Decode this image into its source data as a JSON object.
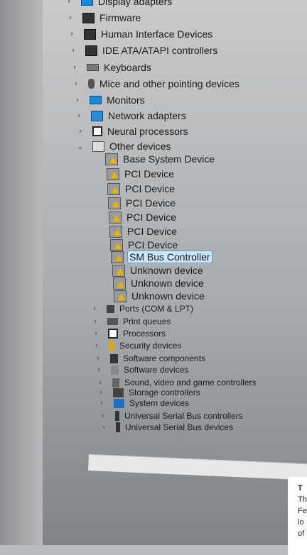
{
  "tree": {
    "items": [
      {
        "label": "Display adapters",
        "expanded": false,
        "icon": "monitor-icon"
      },
      {
        "label": "Firmware",
        "expanded": false,
        "icon": "chip-icon"
      },
      {
        "label": "Human Interface Devices",
        "expanded": false,
        "icon": "hid-icon"
      },
      {
        "label": "IDE ATA/ATAPI controllers",
        "expanded": false,
        "icon": "ide-icon"
      },
      {
        "label": "Keyboards",
        "expanded": false,
        "icon": "keyboard-icon"
      },
      {
        "label": "Mice and other pointing devices",
        "expanded": false,
        "icon": "mouse-icon"
      },
      {
        "label": "Monitors",
        "expanded": false,
        "icon": "monitor-icon"
      },
      {
        "label": "Network adapters",
        "expanded": false,
        "icon": "network-icon"
      },
      {
        "label": "Neural processors",
        "expanded": false,
        "icon": "processor-icon"
      },
      {
        "label": "Other devices",
        "expanded": true,
        "icon": "other-devices-icon"
      },
      {
        "label": "Base System Device",
        "icon": "warning-device-icon"
      },
      {
        "label": "PCI Device",
        "icon": "warning-device-icon"
      },
      {
        "label": "PCI Device",
        "icon": "warning-device-icon"
      },
      {
        "label": "PCI Device",
        "icon": "warning-device-icon"
      },
      {
        "label": "PCI Device",
        "icon": "warning-device-icon"
      },
      {
        "label": "PCI Device",
        "icon": "warning-device-icon"
      },
      {
        "label": "PCI Device",
        "icon": "warning-device-icon"
      },
      {
        "label": "SM Bus Controller",
        "icon": "warning-device-icon",
        "selected": true
      },
      {
        "label": "Unknown device",
        "icon": "warning-device-icon"
      },
      {
        "label": "Unknown device",
        "icon": "warning-device-icon"
      },
      {
        "label": "Unknown device",
        "icon": "warning-device-icon"
      },
      {
        "label": "Ports (COM & LPT)",
        "expanded": false,
        "icon": "port-icon"
      },
      {
        "label": "Print queues",
        "expanded": false,
        "icon": "printer-icon"
      },
      {
        "label": "Processors",
        "expanded": false,
        "icon": "processor-icon"
      },
      {
        "label": "Security devices",
        "expanded": false,
        "icon": "security-icon"
      },
      {
        "label": "Software components",
        "expanded": false,
        "icon": "software-component-icon"
      },
      {
        "label": "Software devices",
        "expanded": false,
        "icon": "software-device-icon"
      },
      {
        "label": "Sound, video and game controllers",
        "expanded": false,
        "icon": "sound-icon"
      },
      {
        "label": "Storage controllers",
        "expanded": false,
        "icon": "storage-icon"
      },
      {
        "label": "System devices",
        "expanded": false,
        "icon": "system-icon"
      },
      {
        "label": "Universal Serial Bus controllers",
        "expanded": false,
        "icon": "usb-icon"
      },
      {
        "label": "Universal Serial Bus devices",
        "expanded": false,
        "icon": "usb-icon"
      }
    ]
  },
  "side_panel": {
    "lines": [
      "T",
      "Th",
      "Fe",
      "lo",
      "of"
    ]
  },
  "colors": {
    "selection_bg": "#cce4f7",
    "selection_border": "#5a9fd4",
    "warning": "#f0b400"
  }
}
